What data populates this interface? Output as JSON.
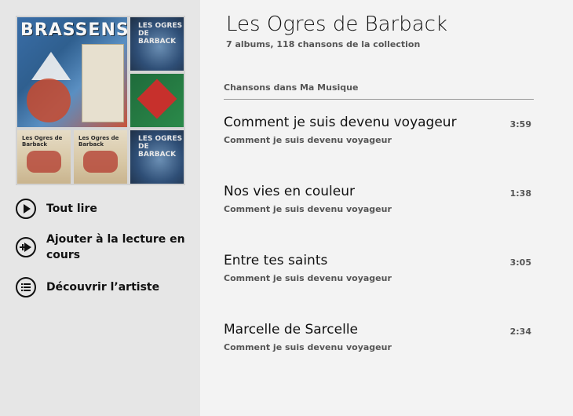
{
  "left_panel": {
    "actions": [
      {
        "label": "Tout lire",
        "icon": "play-icon"
      },
      {
        "label": "Ajouter à la lecture en cours",
        "label_line1": "Ajouter à la lecture en",
        "label_line2": "cours",
        "icon": "add-to-playing-icon"
      },
      {
        "label": "Découvrir l’artiste",
        "icon": "list-icon"
      }
    ],
    "album_tiles": {
      "brassens_title": "BRASSENS",
      "moon_title": "LES OGRES DE BARBACK",
      "beige_title": "Les Ogres de Barback"
    }
  },
  "artist": {
    "name": "Les Ogres de Barback",
    "subtitle": "7 albums, 118 chansons de la collection"
  },
  "section_header": "Chansons dans Ma Musique",
  "songs": [
    {
      "title": "Comment je suis devenu voyageur",
      "album": "Comment je suis devenu voyageur",
      "duration": "3:59"
    },
    {
      "title": "Nos vies en couleur",
      "album": "Comment je suis devenu voyageur",
      "duration": "1:38"
    },
    {
      "title": "Entre tes saints",
      "album": "Comment je suis devenu voyageur",
      "duration": "3:05"
    },
    {
      "title": "Marcelle de Sarcelle",
      "album": "Comment je suis devenu voyageur",
      "duration": "2:34"
    }
  ]
}
